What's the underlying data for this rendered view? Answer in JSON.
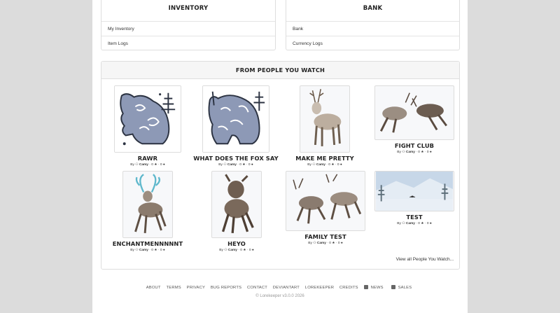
{
  "inventory": {
    "title": "INVENTORY",
    "links": [
      "My Inventory",
      "Item Logs"
    ]
  },
  "bank": {
    "title": "BANK",
    "links": [
      "Bank",
      "Currency Logs"
    ]
  },
  "watch": {
    "title": "FROM PEOPLE YOU WATCH",
    "view_all": "View all People You Watch...",
    "meta_by": "By",
    "items": [
      {
        "title": "RAWR",
        "user": "Camy",
        "favs": "0",
        "comments": "0"
      },
      {
        "title": "WHAT DOES THE FOX SAY",
        "user": "Camy",
        "favs": "0",
        "comments": "0"
      },
      {
        "title": "MAKE ME PRETTY",
        "user": "Camy",
        "favs": "0",
        "comments": "0"
      },
      {
        "title": "FIGHT CLUB",
        "user": "Camy",
        "favs": "0",
        "comments": "0"
      },
      {
        "title": "ENCHANTMENNNNNT",
        "user": "Camy",
        "favs": "0",
        "comments": "0"
      },
      {
        "title": "HEYO",
        "user": "Camy",
        "favs": "0",
        "comments": "0"
      },
      {
        "title": "FAMILY TEST",
        "user": "Camy",
        "favs": "0",
        "comments": "0"
      },
      {
        "title": "TEST",
        "user": "Camy",
        "favs": "0",
        "comments": "0"
      }
    ]
  },
  "footer": {
    "links": [
      "ABOUT",
      "TERMS",
      "PRIVACY",
      "BUG REPORTS",
      "CONTACT",
      "DEVIANTART",
      "LOREKEEPER",
      "CREDITS",
      "NEWS",
      "SALES"
    ],
    "copyright": "© Lorekeeper v3.0.0 2026"
  }
}
